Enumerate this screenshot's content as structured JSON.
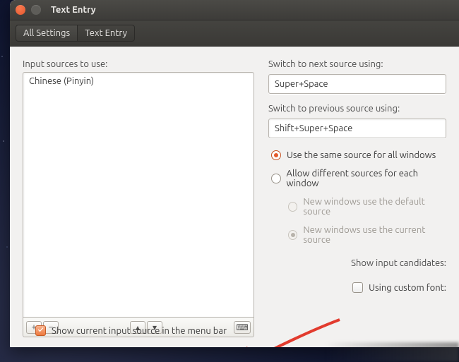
{
  "window": {
    "title": "Text Entry"
  },
  "breadcrumb": {
    "all_settings": "All Settings",
    "current": "Text Entry"
  },
  "left": {
    "heading": "Input sources to use:",
    "sources": [
      "Chinese (Pinyin)"
    ],
    "btn_add": "+",
    "btn_remove": "−",
    "btn_up": "▴",
    "btn_down": "▾",
    "btn_keyboard": "⌨"
  },
  "right": {
    "next_label": "Switch to next source using:",
    "next_value": "Super+Space",
    "prev_label": "Switch to previous source using:",
    "prev_value": "Shift+Super+Space",
    "radio_same": "Use the same source for all windows",
    "radio_diff": "Allow different sources for each window",
    "sub_default": "New windows use the default source",
    "sub_current": "New windows use the current source",
    "show_candidates": "Show input candidates:",
    "using_custom": "Using custom font:"
  },
  "footer": {
    "show_in_menu": "Show current input source in the menu bar"
  }
}
